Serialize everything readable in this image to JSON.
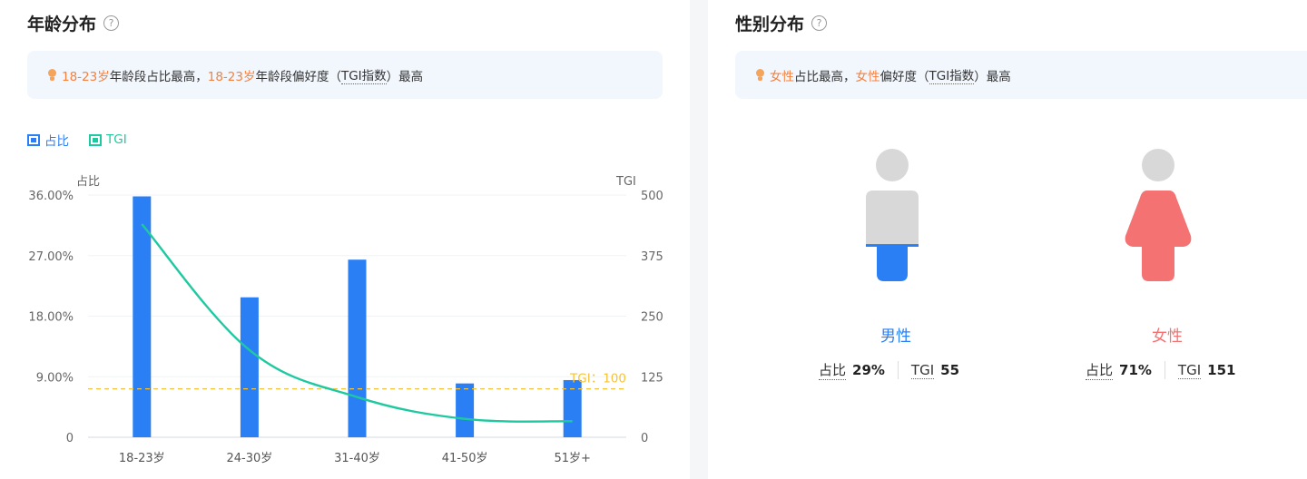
{
  "age_panel": {
    "title": "年龄分布",
    "banner": {
      "group1": "18-23岁",
      "text1": "年龄段占比最高，",
      "group2": "18-23岁",
      "text2": "年龄段偏好度（",
      "tgi": "TGI指数",
      "text3": "）最高"
    }
  },
  "gender_panel": {
    "title": "性别分布",
    "banner": {
      "group1": "女性",
      "text1": "占比最高，",
      "group2": "女性",
      "text2": "偏好度（",
      "tgi": "TGI指数",
      "text3": "）最高"
    },
    "male": {
      "label": "男性",
      "share_label": "占比",
      "share": "29%",
      "tgi_label": "TGI",
      "tgi": "55",
      "share_value": 0.29
    },
    "female": {
      "label": "女性",
      "share_label": "占比",
      "share": "71%",
      "tgi_label": "TGI",
      "tgi": "151",
      "share_value": 0.71
    }
  },
  "colors": {
    "bar": "#2b7ff5",
    "tgi_line": "#1fc9a0",
    "reference": "#f5c33b",
    "male": "#2b7ff5",
    "female": "#f47272",
    "figure_gray": "#d8d8d8",
    "highlight": "#f5813d"
  },
  "chart_data": {
    "type": "bar",
    "categories": [
      "18-23岁",
      "24-30岁",
      "31-40岁",
      "41-50岁",
      "51岁+"
    ],
    "series": [
      {
        "name": "占比",
        "type": "bar",
        "axis": "left",
        "values": [
          35.8,
          20.8,
          26.4,
          8.0,
          8.5
        ]
      },
      {
        "name": "TGI",
        "type": "line",
        "axis": "right",
        "values": [
          440,
          180,
          83,
          38,
          33
        ]
      }
    ],
    "left_axis": {
      "label": "占比",
      "ylim": [
        0,
        36
      ],
      "ticks": [
        "0",
        "9.00%",
        "18.00%",
        "27.00%",
        "36.00%"
      ]
    },
    "right_axis": {
      "label": "TGI",
      "ylim": [
        0,
        500
      ],
      "ticks": [
        "0",
        "125",
        "250",
        "375",
        "500"
      ]
    },
    "reference_line": {
      "axis": "right",
      "value": 100,
      "label": "TGI：100"
    },
    "legend": {
      "position": "top-left",
      "items": [
        "占比",
        "TGI"
      ]
    },
    "grid": true
  }
}
